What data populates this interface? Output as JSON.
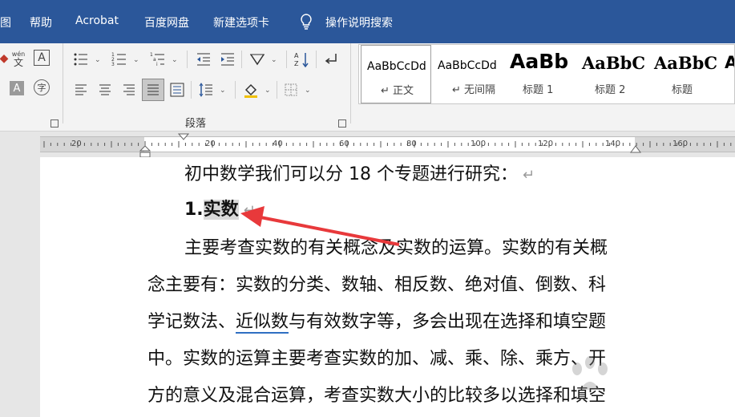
{
  "menubar": {
    "items": [
      "图",
      "帮助",
      "Acrobat",
      "百度网盘",
      "新建选项卡"
    ],
    "search_label": "操作说明搜索"
  },
  "ribbon": {
    "font_group": {
      "phonetic_label": "wén",
      "enclose_char": "字"
    },
    "paragraph_group_label": "段落"
  },
  "styles": [
    {
      "sample": "AaBbCcDd",
      "name": "↵ 正文"
    },
    {
      "sample": "AaBbCcDd",
      "name": "↵ 无间隔"
    },
    {
      "sample": "AaBb",
      "name": "标题 1"
    },
    {
      "sample": "AaBbC",
      "name": "标题 2"
    },
    {
      "sample": "AaBbC",
      "name": "标题"
    },
    {
      "sample": "A",
      "name": ""
    }
  ],
  "ruler": {
    "labels": [
      "20",
      "20",
      "40",
      "60",
      "80",
      "100",
      "120",
      "140",
      "160"
    ]
  },
  "document": {
    "line1": "初中数学我们可以分 18 个专题进行研究：",
    "heading_num": "1.",
    "heading_sel": "实数",
    "para_line1": "主要考查实数的有关概念及实数的运算。实数的有关概",
    "para_line2": "念主要有：实数的分类、数轴、相反数、绝对值、倒数、科",
    "para_line3_pre": "学记数法、",
    "para_line3_underlined": "近似数",
    "para_line3_post": "与有效数字等，多会出现在选择和填空题",
    "para_line4": "中。实数的运算主要考查实数的加、减、乘、除、乘方、开",
    "para_line5": "方的意义及混合运算，考查实数大小的比较多以选择和填空",
    "para_mark": "↵"
  },
  "colors": {
    "menubar": "#2b579a",
    "arrow": "#e8393b",
    "underline": "#2f6fc2"
  }
}
